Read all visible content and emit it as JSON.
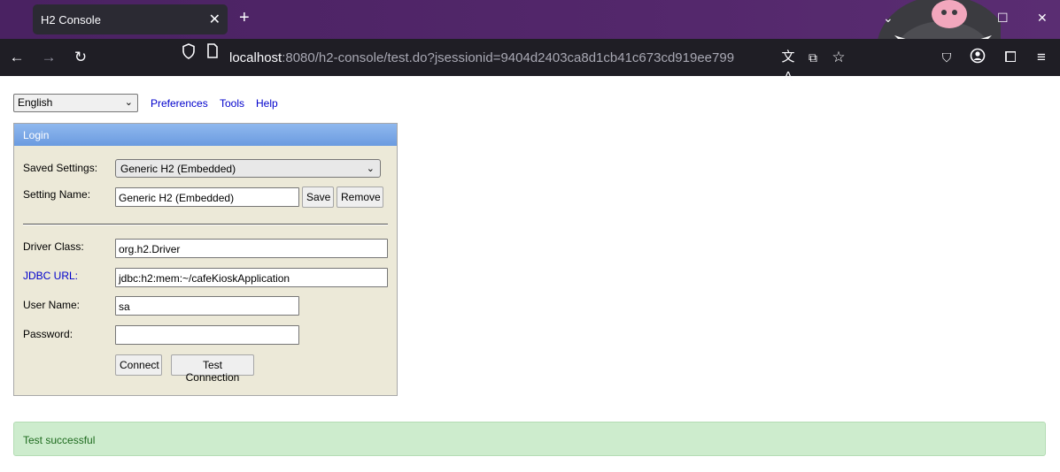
{
  "browser": {
    "tab_title": "H2 Console",
    "tab_close": "✕",
    "new_tab": "+",
    "url_host": "localhost",
    "url_rest": ":8080/h2-console/test.do?jsessionid=9404d2403ca8d1cb41c673cd919ee799",
    "accent": "#4b2362"
  },
  "page": {
    "language": "English",
    "links": {
      "preferences": "Preferences",
      "tools": "Tools",
      "help": "Help"
    },
    "login": {
      "title": "Login",
      "saved_settings_label": "Saved Settings:",
      "saved_settings_value": "Generic H2 (Embedded)",
      "setting_name_label": "Setting Name:",
      "setting_name_value": "Generic H2 (Embedded)",
      "save_label": "Save",
      "remove_label": "Remove",
      "driver_class_label": "Driver Class:",
      "driver_class_value": "org.h2.Driver",
      "jdbc_url_label": "JDBC URL:",
      "jdbc_url_value": "jdbc:h2:mem:~/cafeKioskApplication",
      "user_name_label": "User Name:",
      "user_name_value": "sa",
      "password_label": "Password:",
      "password_value": "",
      "connect_label": "Connect",
      "test_connection_label": "Test Connection"
    },
    "status_message": "Test successful",
    "status_color": "#cdeccd"
  }
}
